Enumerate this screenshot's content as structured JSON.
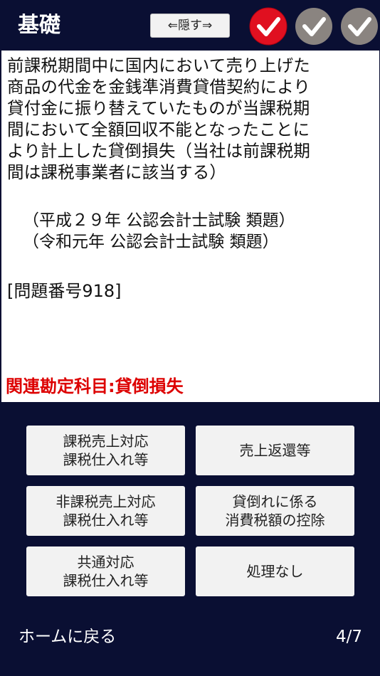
{
  "header": {
    "title": "基礎",
    "hide_label": "⇐隠す⇒"
  },
  "checks": [
    {
      "state": "active",
      "color": "#e01020",
      "icon": "check-icon"
    },
    {
      "state": "inactive",
      "color": "#8a8480",
      "icon": "check-icon"
    },
    {
      "state": "inactive",
      "color": "#8a8480",
      "icon": "check-icon"
    }
  ],
  "question": {
    "text_lines": [
      "前課税期間中に国内において売り上げた",
      "商品の代金を金銭準消費貸借契約により",
      "貸付金に振り替えていたものが当課税期",
      "間において全額回収不能となったことに",
      "より計上した貸倒損失（当社は前課税期",
      "間は課税事業者に該当する）"
    ],
    "sources": [
      "（平成２９年  公認会計士試験  類題）",
      "（令和元年  公認会計士試験  類題）"
    ],
    "problem_number": "[問題番号918]",
    "related_account": "関連勘定科目:貸倒損失"
  },
  "answers": [
    {
      "line1": "課税売上対応",
      "line2": "課税仕入れ等"
    },
    {
      "line1": "売上返還等",
      "line2": ""
    },
    {
      "line1": "非課税売上対応",
      "line2": "課税仕入れ等"
    },
    {
      "line1": "貸倒れに係る",
      "line2": "消費税額の控除"
    },
    {
      "line1": "共通対応",
      "line2": "課税仕入れ等"
    },
    {
      "line1": "処理なし",
      "line2": ""
    }
  ],
  "footer": {
    "home_label": "ホームに戻る",
    "page_counter": "4/7"
  },
  "colors": {
    "background": "#0a0f33",
    "accent_red": "#dd0000"
  }
}
